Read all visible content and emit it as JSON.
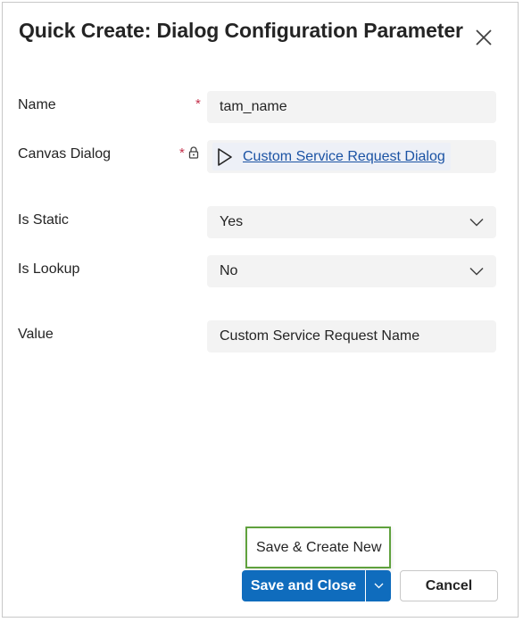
{
  "dialog": {
    "title": "Quick Create: Dialog Configuration Parameter"
  },
  "form": {
    "name": {
      "label": "Name",
      "required_mark": "*",
      "value": "tam_name"
    },
    "canvas_dialog": {
      "label": "Canvas Dialog",
      "required_mark": "*",
      "value": "Custom Service Request Dialog",
      "icon": "play-icon",
      "locked": true
    },
    "is_static": {
      "label": "Is Static",
      "value": "Yes"
    },
    "is_lookup": {
      "label": "Is Lookup",
      "value": "No"
    },
    "value": {
      "label": "Value",
      "value": "Custom Service Request Name"
    }
  },
  "footer": {
    "menu_item": "Save & Create New",
    "save_close": "Save and Close",
    "cancel": "Cancel"
  },
  "colors": {
    "primary": "#0f6cbd",
    "required": "#c4314b",
    "link": "#1b53a4",
    "highlight": "#5fa13d",
    "field_bg": "#f3f3f3"
  }
}
